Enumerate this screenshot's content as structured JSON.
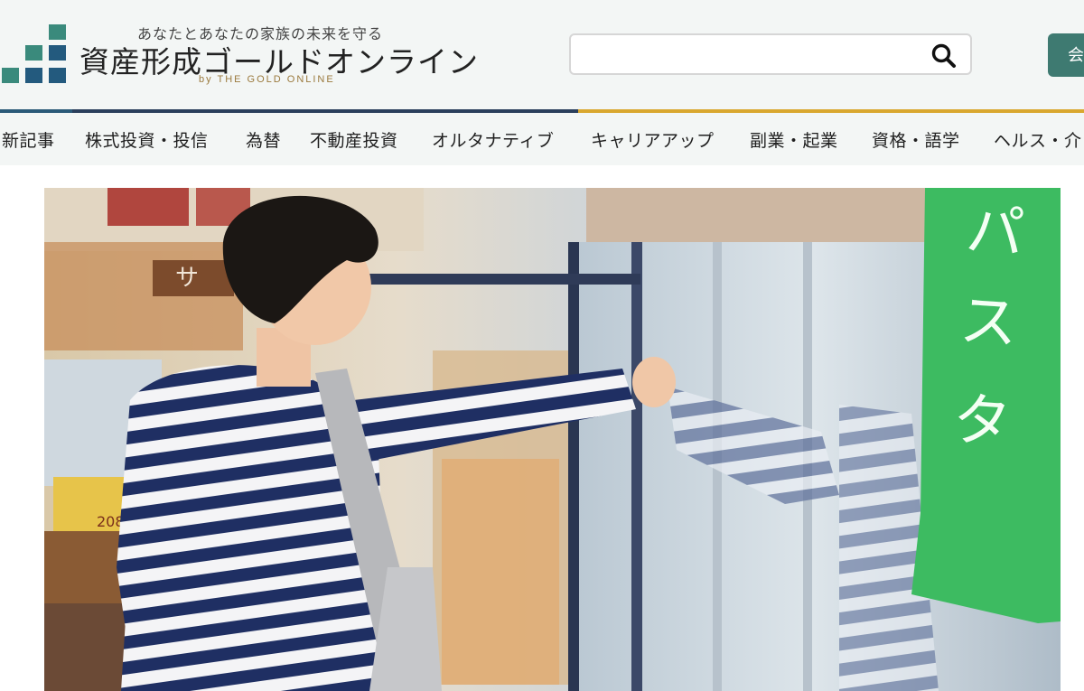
{
  "header": {
    "tagline": "あなたとあなたの家族の未来を守る",
    "site_title": "資産形成ゴールドオンライン",
    "site_subtitle": "by THE GOLD ONLINE",
    "search": {
      "placeholder": "",
      "value": "",
      "icon": "search-icon"
    },
    "member_button_label": "会"
  },
  "nav": {
    "items": [
      {
        "label": "新記事"
      },
      {
        "label": "株式投資・投信"
      },
      {
        "label": "為替"
      },
      {
        "label": "不動産投資"
      },
      {
        "label": "オルタナティブ"
      },
      {
        "label": "キャリアアップ"
      },
      {
        "label": "副業・起業"
      },
      {
        "label": "資格・語学"
      },
      {
        "label": "ヘルス・介"
      }
    ]
  },
  "hero": {
    "sign_text": "パスタ",
    "shelf_sign_text": "サ",
    "price_tag_text": "208"
  },
  "colors": {
    "accent_teal": "#3e7a71",
    "rule_navy": "#2a3f5c",
    "rule_gold": "#d9a72f",
    "header_bg": "#f3f6f5"
  }
}
